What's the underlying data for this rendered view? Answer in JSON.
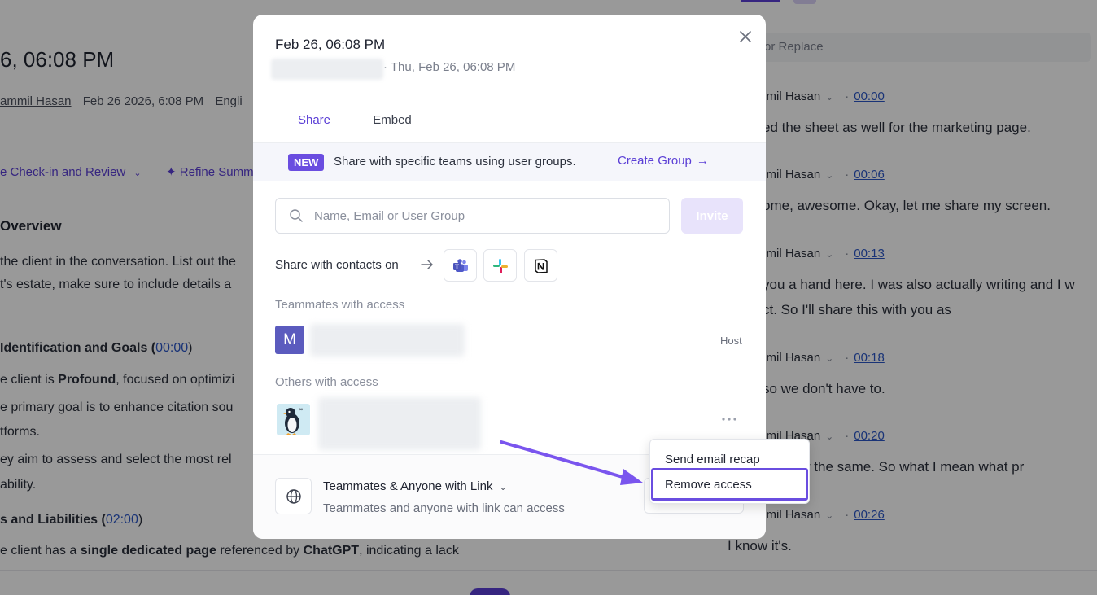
{
  "background": {
    "title": "6, 06:08 PM",
    "meta": {
      "author": "ammil Hasan",
      "date": "Feb 26 2026, 6:08 PM",
      "lang": "Engli"
    },
    "actions": {
      "template": "e Check-in and Review",
      "refine": "Refine Summ"
    },
    "summary": [
      {
        "kind": "h",
        "text": "Overview"
      },
      {
        "kind": "p",
        "text": "the client in the conversation. List out the"
      },
      {
        "kind": "p",
        "text": "t's estate, make sure to include details a"
      },
      {
        "kind": "h2",
        "text": " Identification and Goals (",
        "time": "00:00",
        "tail": ")"
      },
      {
        "kind": "p",
        "pre": "e client is ",
        "bold": "Profound",
        "post": ", focused on optimizi"
      },
      {
        "kind": "p",
        "text": "e primary goal is to enhance citation sou"
      },
      {
        "kind": "p",
        "text": "tforms."
      },
      {
        "kind": "p",
        "text": "ey aim to assess and select the most rel"
      },
      {
        "kind": "p",
        "text": "ability."
      },
      {
        "kind": "h2b",
        "text": "s and Liabilities (",
        "time": "02:00",
        "tail": ")"
      },
      {
        "kind": "p3",
        "pre": "e client has a ",
        "b1": "single dedicated page",
        "mid": " referenced by ",
        "b2": "ChatGPT",
        "post": ", indicating a lack"
      }
    ],
    "transcript": {
      "search_placeholder": "or Replace",
      "entries": [
        {
          "speaker": "mmil Hasan",
          "time": "00:00",
          "text": "ed the sheet as well for the marketing page."
        },
        {
          "speaker": "mmil Hasan",
          "time": "00:06",
          "text": "ome, awesome. Okay, let me share my screen."
        },
        {
          "speaker": "mmil Hasan",
          "time": "00:13",
          "text": "you a hand here. I was also actually writing and I w",
          "text2": "ct. So I'll share this with you as"
        },
        {
          "speaker": "mmil Hasan",
          "time": "00:18",
          "text": "so we don't have to."
        },
        {
          "speaker": "mmil Hasan",
          "time": "00:20",
          "text": "to know the same. So what I mean what pr"
        },
        {
          "speaker": "mmil Hasan",
          "time": "00:26",
          "text": "I know it's."
        }
      ]
    }
  },
  "modal": {
    "title": "Feb 26, 06:08 PM",
    "subtitle": "· Thu, Feb 26, 06:08 PM",
    "tabs": [
      {
        "label": "Share",
        "active": true
      },
      {
        "label": "Embed",
        "active": false
      }
    ],
    "banner": {
      "badge": "NEW",
      "text": "Share with specific teams using user groups.",
      "link": "Create Group"
    },
    "invite": {
      "placeholder": "Name, Email or User Group",
      "button": "Invite"
    },
    "contacts_label": "Share with contacts on",
    "apps": [
      "teams-icon",
      "slack-icon",
      "notion-icon"
    ],
    "teammates_label": "Teammates with access",
    "teammate": {
      "avatar_letter": "M",
      "role": "Host"
    },
    "others_label": "Others with access",
    "footer": {
      "access_title": "Teammates & Anyone with Link",
      "access_desc": "Teammates and anyone with link can access"
    }
  },
  "menu": {
    "items": [
      "Send email recap",
      "Remove access"
    ],
    "highlighted": "Remove access"
  },
  "colors": {
    "accent": "#5b3fd6",
    "badge": "#6a4de0",
    "avatar": "#5b5bbe",
    "overlay": "rgba(0,0,0,0.40)"
  }
}
